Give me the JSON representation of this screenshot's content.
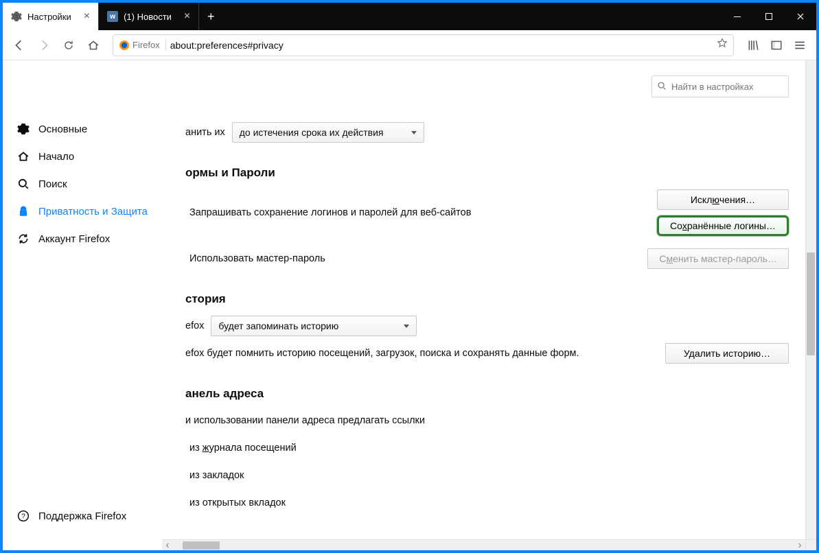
{
  "window": {
    "tabs": [
      {
        "label": "Настройки",
        "icon": "gear"
      },
      {
        "label": "(1) Новости",
        "icon": "vk"
      }
    ],
    "active_tab_index": 0
  },
  "navbar": {
    "identity_label": "Firefox",
    "url": "about:preferences#privacy"
  },
  "search": {
    "placeholder": "Найти в настройках"
  },
  "sidebar": {
    "items": [
      {
        "key": "general",
        "label": "Основные",
        "icon": "gear"
      },
      {
        "key": "home",
        "label": "Начало",
        "icon": "home"
      },
      {
        "key": "search",
        "label": "Поиск",
        "icon": "search"
      },
      {
        "key": "privacy",
        "label": "Приватность и Защита",
        "icon": "lock",
        "active": true
      },
      {
        "key": "account",
        "label": "Аккаунт Firefox",
        "icon": "sync"
      }
    ],
    "support_label": "Поддержка Firefox"
  },
  "prefs": {
    "cookies": {
      "keep_prefix": "анить их",
      "keep_select": "до истечения срока их действия"
    },
    "forms": {
      "heading": "ормы и Пароли",
      "ask_save_label": "Запрашивать сохранение логинов и паролей для веб-сайтов",
      "exceptions_btn": "Исключения…",
      "saved_logins_btn": "Сохранённые логины…",
      "use_master_label": "Использовать мастер-пароль",
      "change_master_btn": "Сменить мастер-пароль…"
    },
    "history": {
      "heading": "стория",
      "prefix": "efox",
      "mode_select": "будет запоминать историю",
      "desc": "efox будет помнить историю посещений, загрузок, поиска и сохранять данные форм.",
      "clear_btn": "Удалить историю…"
    },
    "addressbar": {
      "heading": "анель адреса",
      "intro": "и использовании панели адреса предлагать ссылки",
      "opt1": "из журнала посещений",
      "opt2": "из закладок",
      "opt3": "из открытых вкладок"
    }
  }
}
